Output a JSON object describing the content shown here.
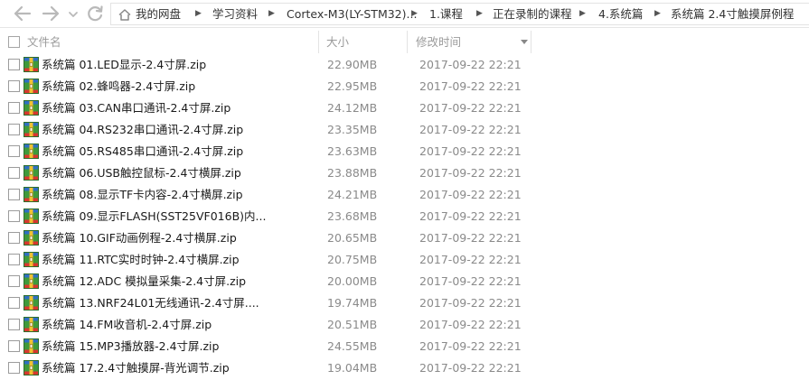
{
  "breadcrumb": [
    {
      "label": "我的网盘"
    },
    {
      "label": "学习资料"
    },
    {
      "label": "Cortex-M3(LY-STM32)..."
    },
    {
      "label": "1.课程"
    },
    {
      "label": "正在录制的课程"
    },
    {
      "label": "4.系统篇"
    },
    {
      "label": "系统篇 2.4寸触摸屏例程"
    }
  ],
  "columns": {
    "name": "文件名",
    "size": "大小",
    "modified": "修改时间"
  },
  "files": [
    {
      "name": "系统篇 01.LED显示-2.4寸屏.zip",
      "size": "22.90MB",
      "modified": "2017-09-22 22:21"
    },
    {
      "name": "系统篇 02.蜂鸣器-2.4寸屏.zip",
      "size": "22.95MB",
      "modified": "2017-09-22 22:21"
    },
    {
      "name": "系统篇 03.CAN串口通讯-2.4寸屏.zip",
      "size": "24.12MB",
      "modified": "2017-09-22 22:21"
    },
    {
      "name": "系统篇 04.RS232串口通讯-2.4寸屏.zip",
      "size": "23.35MB",
      "modified": "2017-09-22 22:21"
    },
    {
      "name": "系统篇 05.RS485串口通讯-2.4寸屏.zip",
      "size": "23.63MB",
      "modified": "2017-09-22 22:21"
    },
    {
      "name": "系统篇 06.USB触控鼠标-2.4寸横屏.zip",
      "size": "23.88MB",
      "modified": "2017-09-22 22:21"
    },
    {
      "name": "系统篇 08.显示TF卡内容-2.4寸横屏.zip",
      "size": "24.21MB",
      "modified": "2017-09-22 22:21"
    },
    {
      "name": "系统篇 09.显示FLASH(SST25VF016B)内...",
      "size": "23.68MB",
      "modified": "2017-09-22 22:21"
    },
    {
      "name": "系统篇 10.GIF动画例程-2.4寸横屏.zip",
      "size": "20.65MB",
      "modified": "2017-09-22 22:21"
    },
    {
      "name": "系统篇 11.RTC实时时钟-2.4寸横屏.zip",
      "size": "20.75MB",
      "modified": "2017-09-22 22:21"
    },
    {
      "name": "系统篇 12.ADC 模拟量采集-2.4寸屏.zip",
      "size": "20.00MB",
      "modified": "2017-09-22 22:21"
    },
    {
      "name": "系统篇 13.NRF24L01无线通讯-2.4寸屏....",
      "size": "19.74MB",
      "modified": "2017-09-22 22:21"
    },
    {
      "name": "系统篇 14.FM收音机-2.4寸屏.zip",
      "size": "20.51MB",
      "modified": "2017-09-22 22:21"
    },
    {
      "name": "系统篇 15.MP3播放器-2.4寸屏.zip",
      "size": "24.55MB",
      "modified": "2017-09-22 22:21"
    },
    {
      "name": "系统篇 17.2.4寸触摸屏-背光调节.zip",
      "size": "19.04MB",
      "modified": "2017-09-22 22:21"
    }
  ],
  "icons": {
    "back": "arrow-left-icon",
    "forward": "arrow-right-icon",
    "history": "chevron-down-icon",
    "refresh": "refresh-icon",
    "home": "home-icon",
    "separator": "chevron-right-icon",
    "file": "zip-archive-icon",
    "sort": "sort-down-icon"
  },
  "colors": {
    "nav_icon": "#b9b9b9",
    "header_text": "#9b9b9b",
    "secondary_text": "#8a8a8a",
    "zip_green": "#3f9a3b",
    "zip_blue": "#2f6fc4",
    "zip_red": "#d8372f",
    "zip_yellow": "#f1c232"
  }
}
